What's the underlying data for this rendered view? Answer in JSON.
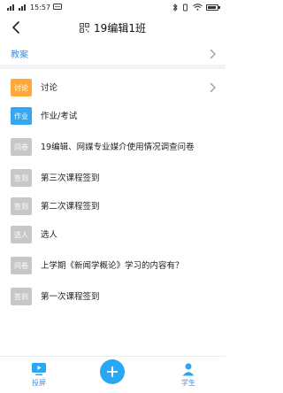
{
  "statusbar": {
    "time": "15:57",
    "battery": "■"
  },
  "header": {
    "title": "19编辑1班",
    "back_icon": "back-arrow-icon",
    "qr_icon": "qr-code-icon"
  },
  "tab": {
    "label": "教案"
  },
  "items": [
    {
      "badge": "讨论",
      "badge_color": "#ffa93b",
      "text": "讨论"
    },
    {
      "badge": "作业",
      "badge_color": "#35a6ef",
      "text": "作业/考试"
    },
    {
      "badge": "问卷",
      "badge_color": "#c7c7c7",
      "text": "19编辑、网媒专业媒介使用情况调查问卷"
    },
    {
      "badge": "签到",
      "badge_color": "#c7c7c7",
      "text": "第三次课程签到"
    },
    {
      "badge": "签到",
      "badge_color": "#c7c7c7",
      "text": "第二次课程签到"
    },
    {
      "badge": "选人",
      "badge_color": "#c7c7c7",
      "text": "选人"
    },
    {
      "badge": "问卷",
      "badge_color": "#c7c7c7",
      "text": "上学期《新闻学概论》学习的内容有？"
    },
    {
      "badge": "签到",
      "badge_color": "#c7c7c7",
      "text": "第一次课程签到"
    }
  ],
  "bottom": {
    "left_label": "投屏",
    "right_label": "学生",
    "fab_icon": "plus-icon"
  }
}
